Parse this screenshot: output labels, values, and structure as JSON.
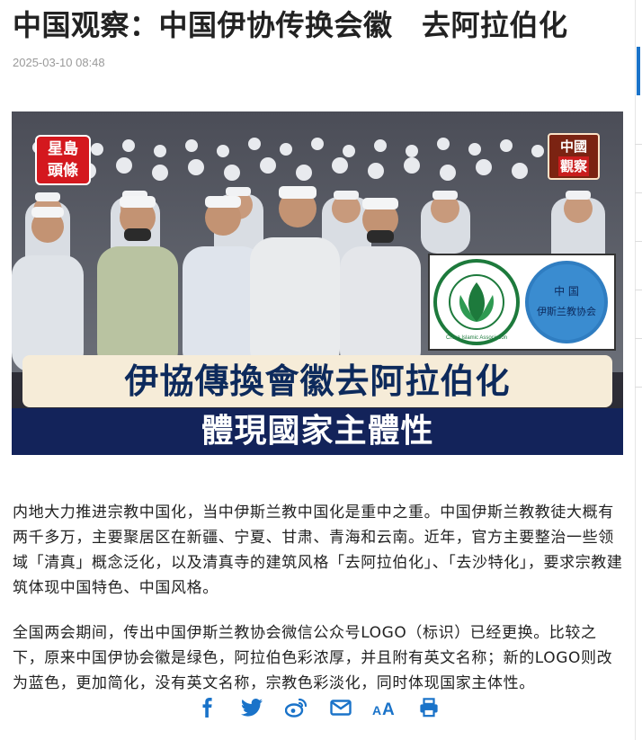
{
  "article": {
    "title": "中国观察：中国伊协传换会徽　去阿拉伯化",
    "date": "2025-03-10 08:48",
    "hero": {
      "brand_line1": "星島",
      "brand_line2": "頭條",
      "badge_line1": "中國",
      "badge_line2": "觀察",
      "logo_old_text": "China Islamic Association",
      "logo_new_line1": "中  国",
      "logo_new_line2": "伊斯兰教协会",
      "banner_line1": "伊協傳換會徽去阿拉伯化",
      "banner_line2": "體現國家主體性"
    },
    "paragraphs": [
      "内地大力推进宗教中国化，当中伊斯兰教中国化是重中之重。中国伊斯兰教教徒大概有两千多万，主要聚居区在新疆、宁夏、甘肃、青海和云南。近年，官方主要整治一些领域「清真」概念泛化，以及清真寺的建筑风格「去阿拉伯化」、「去沙特化」，要求宗教建筑体现中国特色、中国风格。",
      "全国两会期间，传出中国伊斯兰教协会微信公众号LOGO（标识）已经更换。比较之下，原来中国伊协会徽是绿色，阿拉伯色彩浓厚，并且附有英文名称；新的LOGO则改为蓝色，更加简化，没有英文名称，宗教色彩淡化，同时体现国家主体性。"
    ]
  },
  "share_bar": {
    "icons": [
      "facebook-icon",
      "twitter-icon",
      "weibo-icon",
      "email-icon",
      "font-size-icon",
      "print-icon"
    ],
    "icon_color": "#1a73c9"
  },
  "colors": {
    "accent": "#1a73c9",
    "banner_navy": "#13235a",
    "banner_cream": "#f6ecd8",
    "brand_red": "#d4181e"
  }
}
